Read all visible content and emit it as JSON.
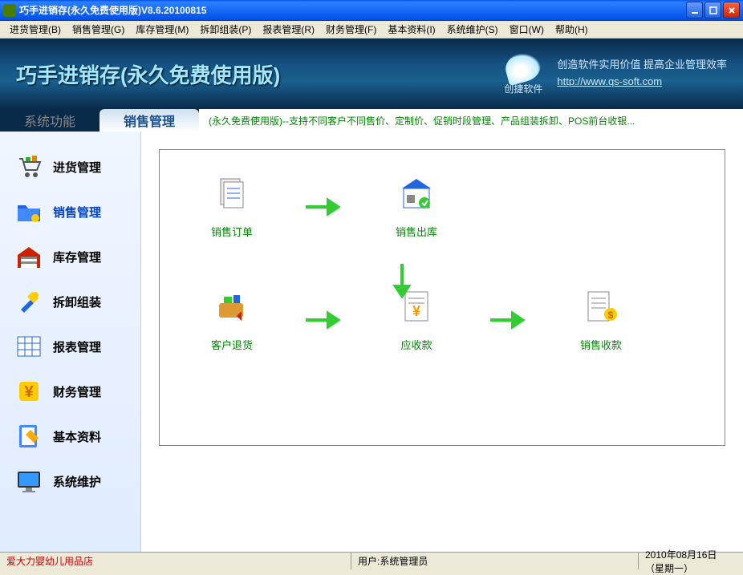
{
  "window": {
    "title": "巧手进销存(永久免费使用版)V8.6.20100815"
  },
  "menu": {
    "items": [
      "进货管理(B)",
      "销售管理(G)",
      "库存管理(M)",
      "拆卸组装(P)",
      "报表管理(R)",
      "财务管理(F)",
      "基本资料(I)",
      "系统维护(S)",
      "窗口(W)",
      "帮助(H)"
    ]
  },
  "banner": {
    "title": "巧手进销存(永久免费使用版)",
    "logo_text": "创捷软件",
    "slogan_line1": "创造软件实用价值  提高企业管理效率",
    "slogan_url": "http://www.qs-soft.com"
  },
  "tabs": {
    "system": "系统功能",
    "active": "销售管理",
    "marquee": "(永久免费使用版)--支持不同客户不同售价、定制价、促销时段管理、产品组装拆卸、POS前台收银..."
  },
  "sidebar": {
    "items": [
      {
        "label": "进货管理",
        "icon": "cart-icon"
      },
      {
        "label": "销售管理",
        "icon": "folder-icon",
        "active": true
      },
      {
        "label": "库存管理",
        "icon": "warehouse-icon"
      },
      {
        "label": "拆卸组装",
        "icon": "tools-icon"
      },
      {
        "label": "报表管理",
        "icon": "grid-icon"
      },
      {
        "label": "财务管理",
        "icon": "yen-icon"
      },
      {
        "label": "基本资料",
        "icon": "notebook-icon"
      },
      {
        "label": "系统维护",
        "icon": "monitor-icon"
      }
    ]
  },
  "flow": {
    "row1": [
      {
        "label": "销售订单",
        "icon": "document-icon"
      },
      {
        "label": "销售出库",
        "icon": "store-out-icon"
      }
    ],
    "row2": [
      {
        "label": "客户退货",
        "icon": "return-icon"
      },
      {
        "label": "应收款",
        "icon": "receivable-icon"
      },
      {
        "label": "销售收款",
        "icon": "payment-icon"
      }
    ]
  },
  "status": {
    "shop": "爱大力婴幼儿用品店",
    "user_label": "用户:",
    "user": "系统管理员",
    "date": "2010年08月16日 （星期一）"
  }
}
